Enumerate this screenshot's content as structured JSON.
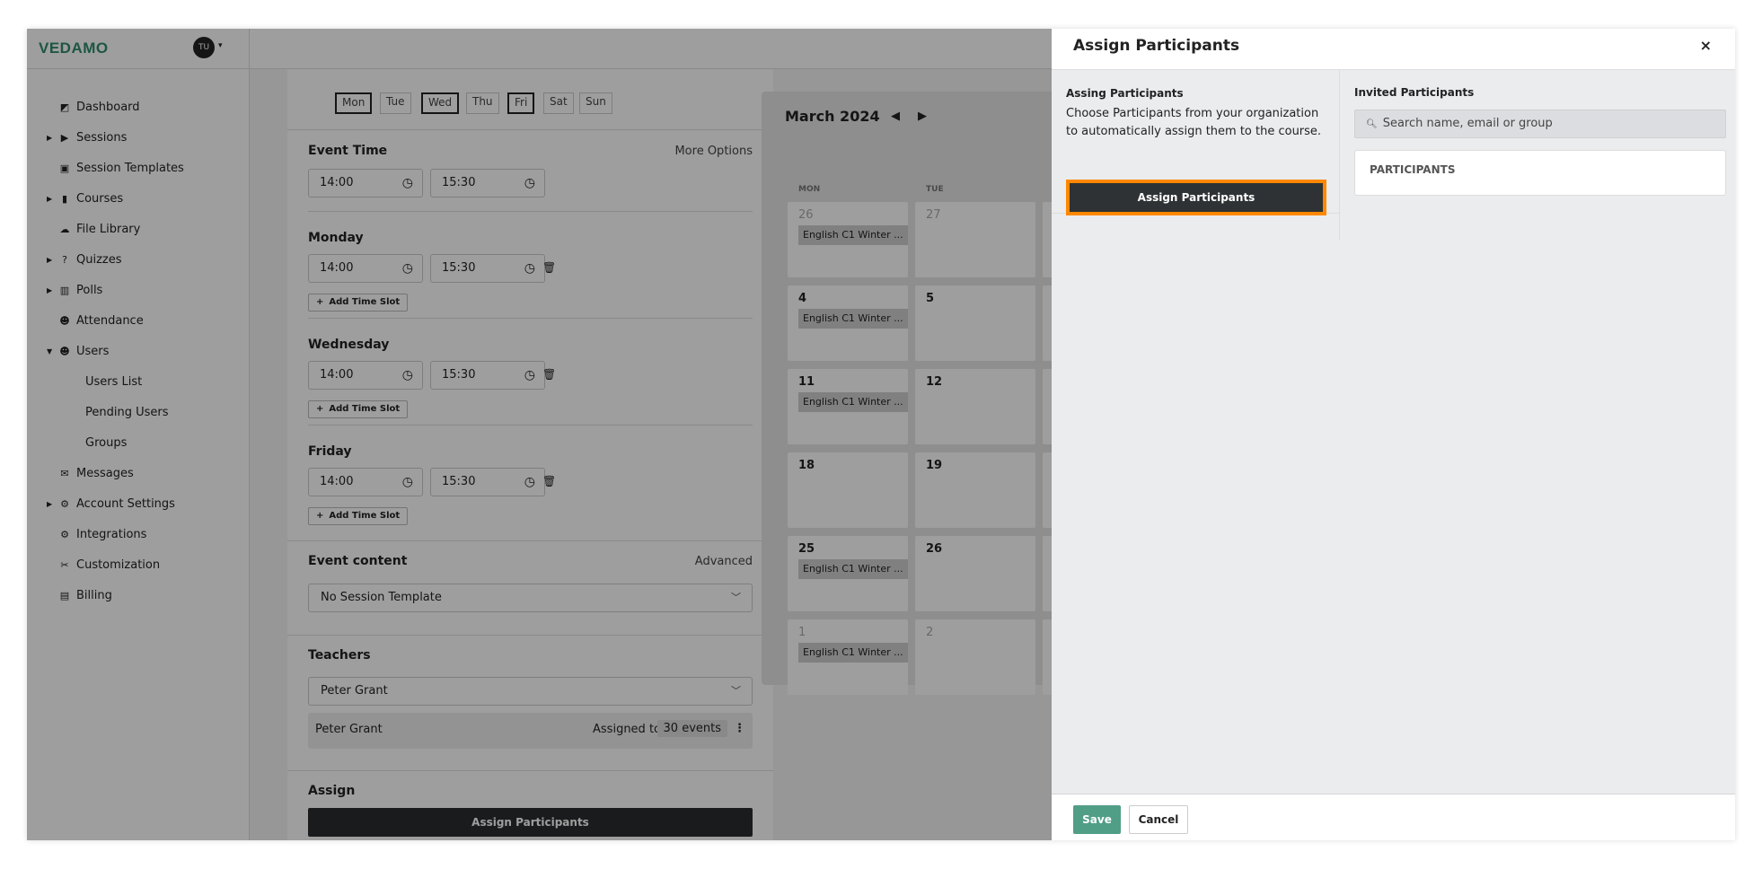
{
  "brand": {
    "logo": "VEDAMO",
    "avatar": "TU",
    "accent": "#2f8c6c"
  },
  "sidebar": {
    "items": [
      {
        "label": "Dashboard",
        "icon": "dashboard-icon",
        "glyph": "◩"
      },
      {
        "label": "Sessions",
        "icon": "play-circle-icon",
        "glyph": "▶",
        "expandable": true
      },
      {
        "label": "Session Templates",
        "icon": "template-icon",
        "glyph": "▣"
      },
      {
        "label": "Courses",
        "icon": "book-icon",
        "glyph": "▮",
        "expandable": true
      },
      {
        "label": "File Library",
        "icon": "cloud-upload-icon",
        "glyph": "☁"
      },
      {
        "label": "Quizzes",
        "icon": "question-circle-icon",
        "glyph": "?",
        "expandable": true
      },
      {
        "label": "Polls",
        "icon": "bar-chart-icon",
        "glyph": "▥",
        "expandable": true
      },
      {
        "label": "Attendance",
        "icon": "user-check-icon",
        "glyph": "☻"
      },
      {
        "label": "Users",
        "icon": "users-icon",
        "glyph": "☻",
        "expanded": true
      },
      {
        "label": "Users List",
        "sub": true
      },
      {
        "label": "Pending Users",
        "sub": true
      },
      {
        "label": "Groups",
        "sub": true
      },
      {
        "label": "Messages",
        "icon": "envelope-icon",
        "glyph": "✉"
      },
      {
        "label": "Account Settings",
        "icon": "gear-icon",
        "glyph": "⚙",
        "expandable": true
      },
      {
        "label": "Integrations",
        "icon": "cogs-icon",
        "glyph": "⚙"
      },
      {
        "label": "Customization",
        "icon": "tools-icon",
        "glyph": "✂"
      },
      {
        "label": "Billing",
        "icon": "invoice-icon",
        "glyph": "▤"
      }
    ]
  },
  "form": {
    "days": [
      {
        "label": "Mon",
        "selected": true
      },
      {
        "label": "Tue",
        "selected": false
      },
      {
        "label": "Wed",
        "selected": true
      },
      {
        "label": "Thu",
        "selected": false
      },
      {
        "label": "Fri",
        "selected": true
      },
      {
        "label": "Sat",
        "selected": false
      },
      {
        "label": "Sun",
        "selected": false
      }
    ],
    "event_time": {
      "label": "Event Time",
      "more": "More Options",
      "start": "14:00",
      "end": "15:30"
    },
    "schedule": [
      {
        "day": "Monday",
        "start": "14:00",
        "end": "15:30"
      },
      {
        "day": "Wednesday",
        "start": "14:00",
        "end": "15:30"
      },
      {
        "day": "Friday",
        "start": "14:00",
        "end": "15:30"
      }
    ],
    "add_slot": "Add Time Slot",
    "event_content": {
      "label": "Event content",
      "advanced": "Advanced",
      "value": "No Session Template"
    },
    "teachers": {
      "label": "Teachers",
      "value": "Peter Grant",
      "row_name": "Peter Grant",
      "assigned_label": "Assigned to",
      "assigned_count": "30 events"
    },
    "assign": {
      "label": "Assign",
      "button": "Assign Participants"
    }
  },
  "calendar": {
    "title": "March 2024",
    "day_headers": [
      "MON",
      "TUE"
    ],
    "rows": [
      [
        {
          "n": "26",
          "dim": true,
          "event": "English C1 Winter ..."
        },
        {
          "n": "27",
          "dim": true
        }
      ],
      [
        {
          "n": "4",
          "event": "English C1 Winter ..."
        },
        {
          "n": "5"
        }
      ],
      [
        {
          "n": "11",
          "event": "English C1 Winter ..."
        },
        {
          "n": "12"
        }
      ],
      [
        {
          "n": "18"
        },
        {
          "n": "19"
        }
      ],
      [
        {
          "n": "25",
          "event": "English C1 Winter ..."
        },
        {
          "n": "26"
        }
      ],
      [
        {
          "n": "1",
          "dim": true,
          "event": "English C1 Winter ..."
        },
        {
          "n": "2",
          "dim": true
        }
      ]
    ]
  },
  "modal": {
    "title": "Assign Participants",
    "close": "×",
    "left_title": "Assing Participants",
    "left_desc": "Choose Participants from your organization to automatically assign them to the course.",
    "left_button": "Assign Participants",
    "right_title": "Invited Participants",
    "search_placeholder": "Search name, email or group",
    "participants_header": "PARTICIPANTS",
    "save": "Save",
    "cancel": "Cancel",
    "save_color": "#519e86",
    "highlight_color": "#ff8800"
  }
}
